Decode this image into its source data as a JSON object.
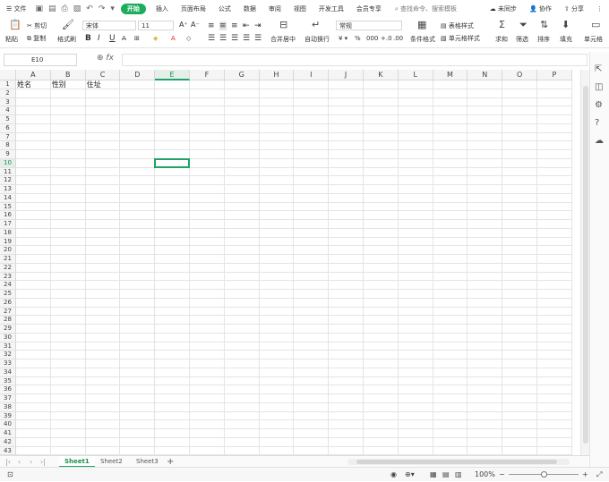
{
  "menubar": {
    "file": "文件",
    "tabs": [
      "开始",
      "插入",
      "页面布局",
      "公式",
      "数据",
      "审阅",
      "视图",
      "开发工具",
      "会员专享"
    ],
    "active_tab": "开始",
    "search": "查找命令、搜索模板",
    "sync": "未同步",
    "collab": "协作",
    "share": "分享"
  },
  "ribbon": {
    "paste": "粘贴",
    "cut": "剪切",
    "copy": "复制",
    "format_painter": "格式刷",
    "font_name": "宋体",
    "font_size": "11",
    "bold": "B",
    "italic": "I",
    "underline": "U",
    "merge": "合并居中",
    "wrap": "自动换行",
    "number_format": "常规",
    "conditional_format": "条件格式",
    "table_style": "表格样式",
    "cell_style": "单元格样式",
    "sum": "求和",
    "filter": "筛选",
    "sort": "排序",
    "fill": "填充",
    "cell": "单元格"
  },
  "formula_bar": {
    "name_box": "E10",
    "fx": "fx",
    "content": ""
  },
  "grid": {
    "columns": [
      "A",
      "B",
      "C",
      "D",
      "E",
      "F",
      "G",
      "H",
      "I",
      "J",
      "K",
      "L",
      "M",
      "N",
      "O",
      "P"
    ],
    "selected_column": "E",
    "selected_row": "10",
    "row_count": 43,
    "cells": [
      {
        "col": "A",
        "row": 1,
        "text": "姓名"
      },
      {
        "col": "B",
        "row": 1,
        "text": "性别"
      },
      {
        "col": "C",
        "row": 1,
        "text": "住址"
      }
    ]
  },
  "sheets": {
    "tabs": [
      "Sheet1",
      "Sheet2",
      "Sheet3"
    ],
    "active": "Sheet1",
    "add": "+"
  },
  "status": {
    "zoom": "100%"
  },
  "icons": [
    "menu-icon",
    "save-icon",
    "print-icon",
    "undo-icon",
    "redo-icon",
    "search-icon",
    "cursor-icon",
    "help-icon"
  ]
}
